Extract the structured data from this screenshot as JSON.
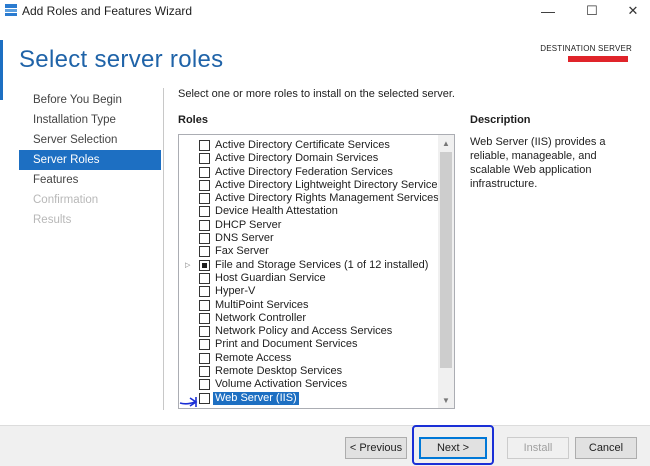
{
  "window": {
    "title": "Add Roles and Features Wizard",
    "minimize_glyph": "—",
    "maximize_glyph": "☐",
    "close_glyph": "✕"
  },
  "page": {
    "title": "Select server roles",
    "destination_label": "DESTINATION SERVER"
  },
  "nav": {
    "items": [
      {
        "label": "Before You Begin",
        "state": "normal"
      },
      {
        "label": "Installation Type",
        "state": "normal"
      },
      {
        "label": "Server Selection",
        "state": "normal"
      },
      {
        "label": "Server Roles",
        "state": "active"
      },
      {
        "label": "Features",
        "state": "normal"
      },
      {
        "label": "Confirmation",
        "state": "disabled"
      },
      {
        "label": "Results",
        "state": "disabled"
      }
    ]
  },
  "main": {
    "instruction": "Select one or more roles to install on the selected server.",
    "roles_heading": "Roles",
    "roles": [
      {
        "label": "Active Directory Certificate Services",
        "state": "unchecked"
      },
      {
        "label": "Active Directory Domain Services",
        "state": "unchecked"
      },
      {
        "label": "Active Directory Federation Services",
        "state": "unchecked"
      },
      {
        "label": "Active Directory Lightweight Directory Services",
        "state": "unchecked"
      },
      {
        "label": "Active Directory Rights Management Services",
        "state": "unchecked"
      },
      {
        "label": "Device Health Attestation",
        "state": "unchecked"
      },
      {
        "label": "DHCP Server",
        "state": "unchecked"
      },
      {
        "label": "DNS Server",
        "state": "unchecked"
      },
      {
        "label": "Fax Server",
        "state": "unchecked"
      },
      {
        "label": "File and Storage Services (1 of 12 installed)",
        "state": "partial",
        "expandable": true
      },
      {
        "label": "Host Guardian Service",
        "state": "unchecked"
      },
      {
        "label": "Hyper-V",
        "state": "unchecked"
      },
      {
        "label": "MultiPoint Services",
        "state": "unchecked"
      },
      {
        "label": "Network Controller",
        "state": "unchecked"
      },
      {
        "label": "Network Policy and Access Services",
        "state": "unchecked"
      },
      {
        "label": "Print and Document Services",
        "state": "unchecked"
      },
      {
        "label": "Remote Access",
        "state": "unchecked"
      },
      {
        "label": "Remote Desktop Services",
        "state": "unchecked"
      },
      {
        "label": "Volume Activation Services",
        "state": "unchecked"
      },
      {
        "label": "Web Server (IIS)",
        "state": "unchecked",
        "selected": true
      }
    ],
    "description_heading": "Description",
    "description_text": "Web Server (IIS) provides a reliable, manageable, and scalable Web application infrastructure."
  },
  "footer": {
    "previous_label": "< Previous",
    "next_label": "Next >",
    "install_label": "Install",
    "cancel_label": "Cancel"
  },
  "colors": {
    "accent": "#1d6fc2",
    "annotation": "#1a2fd6",
    "redaction": "#e0242a"
  }
}
